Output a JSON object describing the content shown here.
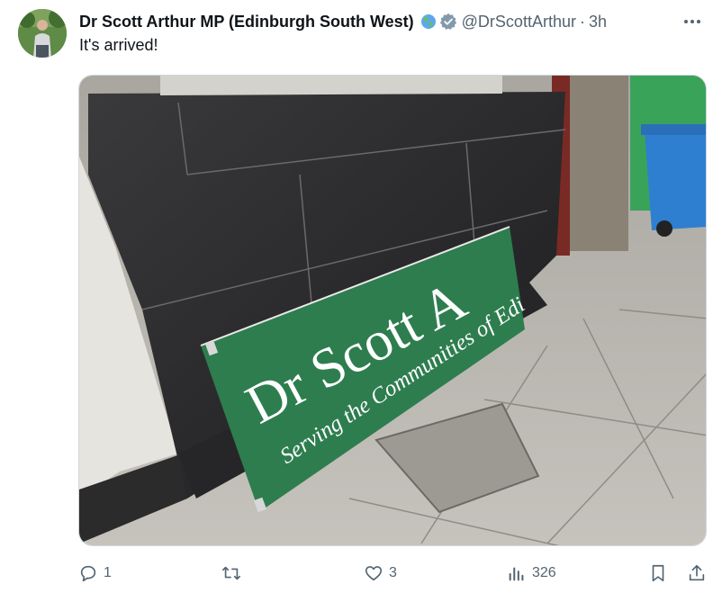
{
  "tweet": {
    "author": {
      "display_name": "Dr Scott Arthur MP (Edinburgh South West)",
      "handle": "@DrScottArthur",
      "avatar_icon": "avatar-photo",
      "badges": [
        "globe-emoji-icon",
        "verified-badge-icon"
      ]
    },
    "separator": "·",
    "timestamp": "3h",
    "text": "It's arrived!",
    "media": {
      "sign_line1": "Dr Scott A",
      "sign_line2": "Serving the Communities of Edi",
      "sign_color": "#2e7d4f"
    },
    "actions": {
      "reply_count": "1",
      "retweet_count": "",
      "like_count": "3",
      "views_count": "326"
    }
  },
  "colors": {
    "text_primary": "#0f1419",
    "text_secondary": "#536471",
    "verified": "#829aab"
  }
}
